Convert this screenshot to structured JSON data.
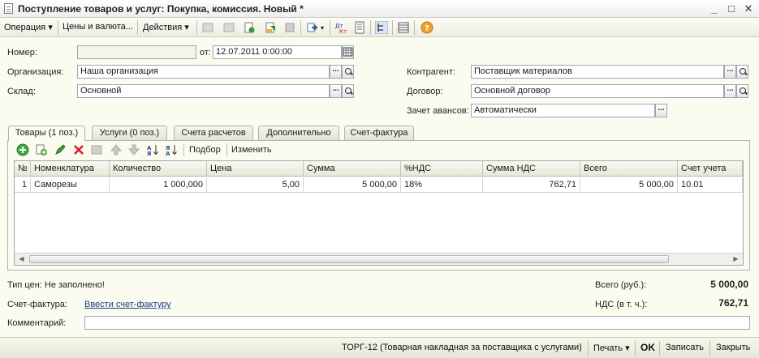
{
  "window": {
    "title": "Поступление товаров и услуг: Покупка, комиссия. Новый *",
    "minimize": "_",
    "maximize": "□",
    "close": "✕"
  },
  "toolbar": {
    "operation_label": "Операция",
    "prices_label": "Цены и валюта...",
    "actions_label": "Действия",
    "icons": [
      "post-icon",
      "unpost-icon",
      "copy-doc-icon",
      "save-green-icon",
      "print-icon",
      "go-based-icon",
      "dt-kt-icon",
      "report-icon",
      "structure-icon",
      "list-icon",
      "help-icon"
    ]
  },
  "header": {
    "number_label": "Номер:",
    "number_value": "",
    "date_label": "от:",
    "date_value": "12.07.2011  0:00:00",
    "org_label": "Организация:",
    "org_value": "Наша организация",
    "warehouse_label": "Склад:",
    "warehouse_value": "Основной",
    "contractor_label": "Контрагент:",
    "contractor_value": "Поставщик материалов",
    "contract_label": "Договор:",
    "contract_value": "Основной договор",
    "advance_label": "Зачет авансов:",
    "advance_value": "Автоматически"
  },
  "tabs": [
    {
      "label": "Товары (1 поз.)",
      "active": true
    },
    {
      "label": "Услуги (0 поз.)",
      "active": false
    },
    {
      "label": "Счета расчетов",
      "active": false
    },
    {
      "label": "Дополнительно",
      "active": false
    },
    {
      "label": "Счет-фактура",
      "active": false
    }
  ],
  "grid_toolbar": {
    "pick_label": "Подбор",
    "change_label": "Изменить"
  },
  "grid": {
    "columns": [
      "№",
      "Номенклатура",
      "Количество",
      "Цена",
      "Сумма",
      "%НДС",
      "Сумма НДС",
      "Всего",
      "Счет учета"
    ],
    "rows": [
      [
        "1",
        "Саморезы",
        "1 000,000",
        "5,00",
        "5 000,00",
        "18%",
        "762,71",
        "5 000,00",
        "10.01"
      ]
    ]
  },
  "footer": {
    "price_type_text": "Тип цен: Не заполнено!",
    "total_label": "Всего (руб.):",
    "total_value": "5 000,00",
    "invoice_label": "Счет-фактура:",
    "invoice_link": "Ввести счет-фактуру",
    "vat_label": "НДС (в т. ч.):",
    "vat_value": "762,71",
    "comment_label": "Комментарий:",
    "comment_value": ""
  },
  "statusbar": {
    "form_label": "ТОРГ-12 (Товарная накладная за поставщика с услугами)",
    "print_label": "Печать",
    "ok_label": "OK",
    "save_label": "Записать",
    "close_label": "Закрыть"
  }
}
